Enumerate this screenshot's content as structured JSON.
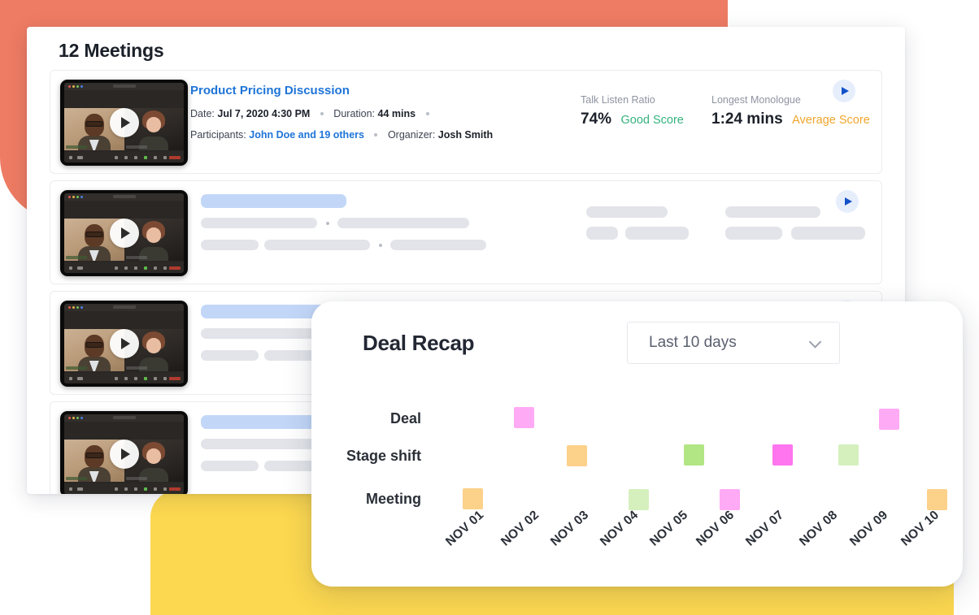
{
  "background": {
    "coral_color": "#ee7b63",
    "yellow_color": "#fcd850"
  },
  "meetings_panel": {
    "title": "12 Meetings",
    "rows": [
      {
        "loaded": true,
        "thumbnail_name": "meeting-video-thumbnail",
        "play_overlay_label": "play-overlay",
        "title": "Product Pricing Discussion",
        "meta_line_1": {
          "date_label": "Date:",
          "date_value": "Jul 7, 2020 4:30 PM",
          "duration_label": "Duration:",
          "duration_value": "44 mins"
        },
        "meta_line_2": {
          "participants_label": "Participants:",
          "participants_value": "John Doe and 19 others",
          "organizer_label": "Organizer:",
          "organizer_value": "Josh Smith"
        },
        "metrics": [
          {
            "label": "Talk Listen Ratio",
            "value": "74%",
            "score": "Good Score",
            "score_color": "#35b37e"
          },
          {
            "label": "Longest Monologue",
            "value": "1:24 mins",
            "score": "Average Score",
            "score_color": "#f0a62c"
          }
        ],
        "play_button_name": "play-button"
      },
      {
        "loaded": false,
        "play_button_name": "play-button"
      },
      {
        "loaded": false,
        "play_button_name": "play-button"
      },
      {
        "loaded": false,
        "play_button_name": "play-button"
      }
    ],
    "skeleton_colors": {
      "title_bar": "#c2d7f8",
      "text_bar": "#e2e4e9"
    }
  },
  "deal_recap": {
    "title": "Deal Recap",
    "range_selector": {
      "selected": "Last 10 days",
      "icon": "chevron-down-icon"
    },
    "chart_data": {
      "type": "scatter",
      "title": "Deal Recap",
      "xlabel": "",
      "ylabel": "",
      "grid": false,
      "legend": "none",
      "categories": [
        "NOV 01",
        "NOV 02",
        "NOV 03",
        "NOV 04",
        "NOV 05",
        "NOV 06",
        "NOV 07",
        "NOV 08",
        "NOV 09",
        "NOV 10"
      ],
      "rows": [
        "Deal",
        "Stage shift",
        "Meeting"
      ],
      "series": [
        {
          "name": "Deal",
          "row": 0,
          "points": [
            {
              "x": "NOV 02",
              "color": "#ffaaf5"
            },
            {
              "x": "NOV 09",
              "color": "#ffaaf5"
            }
          ]
        },
        {
          "name": "Stage shift",
          "row": 1,
          "points": [
            {
              "x": "NOV 03",
              "color": "#fcd18a"
            },
            {
              "x": "NOV 05",
              "color": "#b2e583"
            },
            {
              "x": "NOV 07",
              "color": "#ff74ef"
            },
            {
              "x": "NOV 08",
              "color": "#d5f0bd"
            }
          ]
        },
        {
          "name": "Meeting",
          "row": 2,
          "points": [
            {
              "x": "NOV 01",
              "color": "#fcd18a"
            },
            {
              "x": "NOV 04",
              "color": "#d5f0bd"
            },
            {
              "x": "NOV 06",
              "color": "#ffaaf5"
            },
            {
              "x": "NOV 10",
              "color": "#fcd18a"
            }
          ]
        }
      ]
    }
  }
}
